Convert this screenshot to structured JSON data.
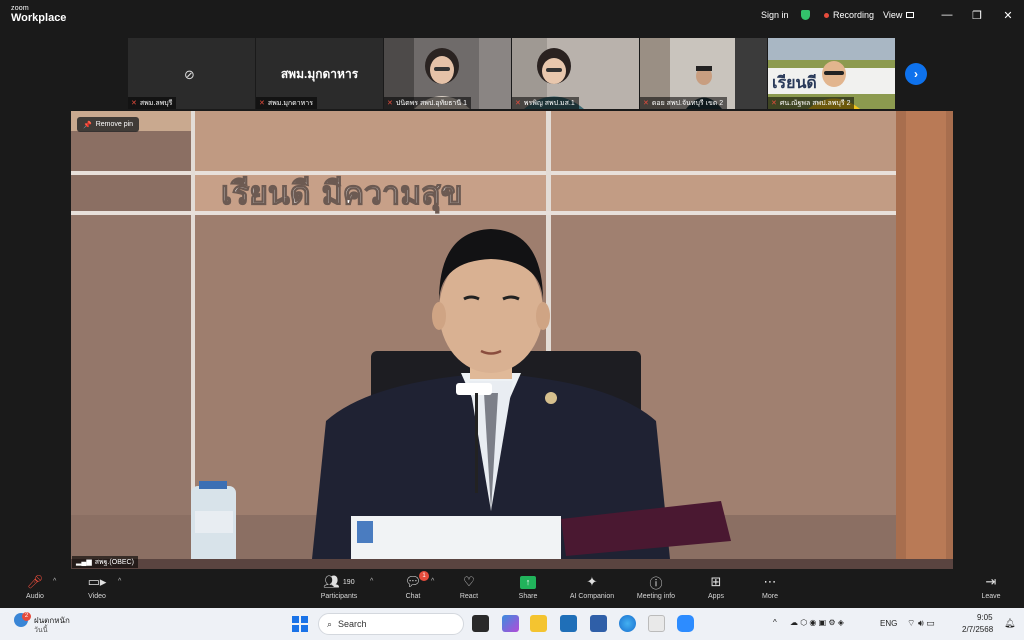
{
  "titlebar": {
    "brand_top": "zoom",
    "brand_bottom": "Workplace",
    "sign_in": "Sign in",
    "recording": "Recording",
    "view": "View",
    "minimize": "—",
    "restore": "❐",
    "close": "✕"
  },
  "participants_strip": [
    {
      "name": "สพม.ลพบุรี",
      "video": false
    },
    {
      "name": "สพม.มุกดาหาร",
      "video": false,
      "display_name": "สพม.มุกดาหาร"
    },
    {
      "name": "ปนิตพร สพป.อุทัยธานี 1",
      "video": true
    },
    {
      "name": "พรพิญ สพป.มส.1",
      "video": true
    },
    {
      "name": "ดอย สพป.จันทบุรี เขต 2",
      "video": true
    },
    {
      "name": "ศน.ณัฐพล สพป.ลพบุรี 2",
      "video": true
    }
  ],
  "stage": {
    "remove_pin": "Remove pin",
    "speaker_label": "สพฐ.(OBEC)",
    "slogan": "เรียนดี มีความสุข"
  },
  "controls": {
    "audio": "Audio",
    "video": "Video",
    "participants": "Participants",
    "participants_count": "190",
    "chat": "Chat",
    "chat_badge": "1",
    "react": "React",
    "share": "Share",
    "ai_companion": "AI Companion",
    "meeting_info": "Meeting info",
    "apps": "Apps",
    "more": "More",
    "leave": "Leave"
  },
  "taskbar": {
    "weather_title": "ฝนตกหนัก",
    "weather_sub": "วันนี้",
    "weather_badge": "2",
    "search": "Search",
    "lang": "ENG",
    "time": "9:05",
    "date": "2/7/2568"
  }
}
